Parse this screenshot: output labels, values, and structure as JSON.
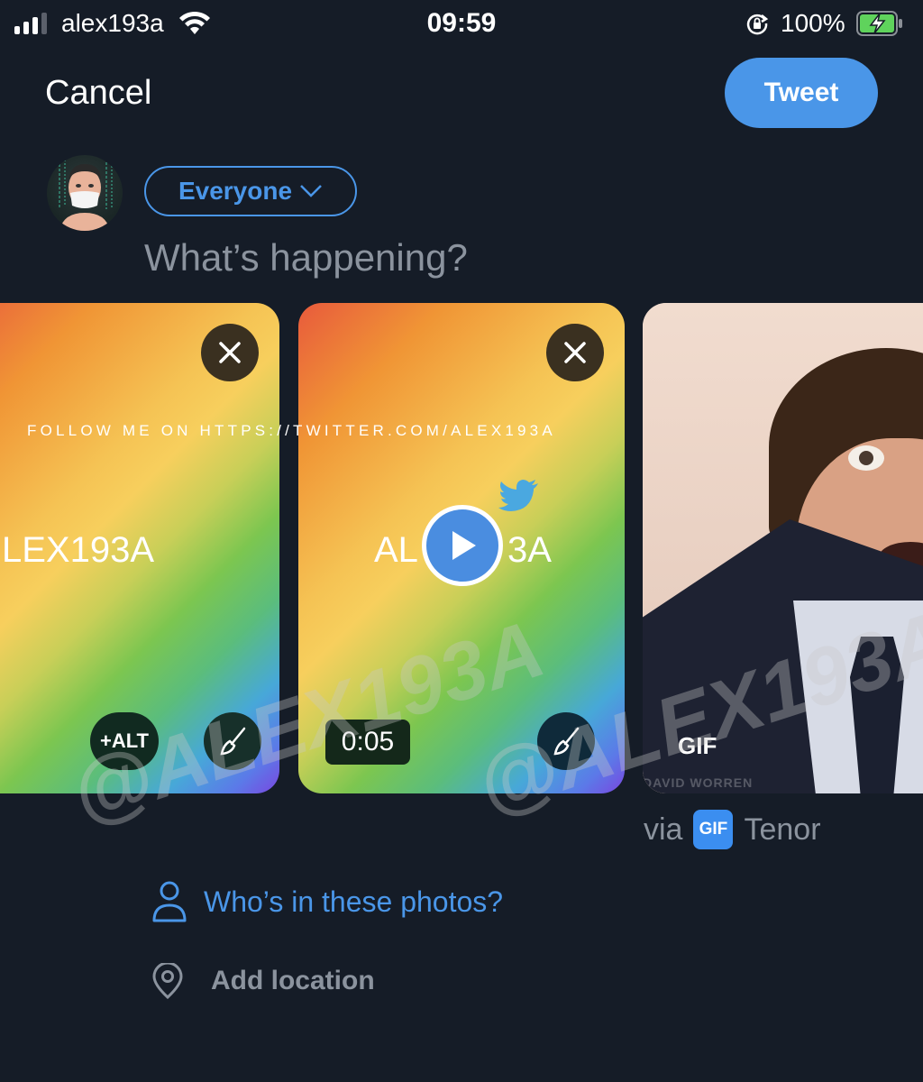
{
  "status_bar": {
    "carrier": "alex193a",
    "time": "09:59",
    "battery_percent": "100%",
    "signal_bars_active": 3,
    "signal_bars_total": 4,
    "icons": [
      "signal-icon",
      "wifi-icon",
      "orientation-lock-icon",
      "battery-charging-icon"
    ]
  },
  "header": {
    "cancel_label": "Cancel",
    "tweet_label": "Tweet",
    "accent_color": "#4a96e8"
  },
  "composer": {
    "audience_label": "Everyone",
    "placeholder": "What’s happening?",
    "value": ""
  },
  "media": [
    {
      "type": "image",
      "overlay_text": "FOLLOW ME ON HTTPS://TWITTER.COM/ALEX193A",
      "center_text": "LEX193A",
      "alt_button_label": "+ALT",
      "icons": [
        "close-icon",
        "edit-brush-icon"
      ]
    },
    {
      "type": "video",
      "center_text_left": "AL",
      "center_text_right": "3A",
      "duration": "0:05",
      "icons": [
        "close-icon",
        "play-icon",
        "twitter-bird-icon",
        "edit-brush-icon"
      ]
    },
    {
      "type": "gif",
      "badge": "GIF",
      "credit": "DAVID WORREN",
      "via_prefix": "via",
      "tenor_badge": "GIF",
      "provider": "Tenor"
    }
  ],
  "watermarks": [
    "@ALEX193A",
    "@ALEX193A"
  ],
  "actions": {
    "tag_people_label": "Who’s in these photos?",
    "add_location_label": "Add location"
  }
}
